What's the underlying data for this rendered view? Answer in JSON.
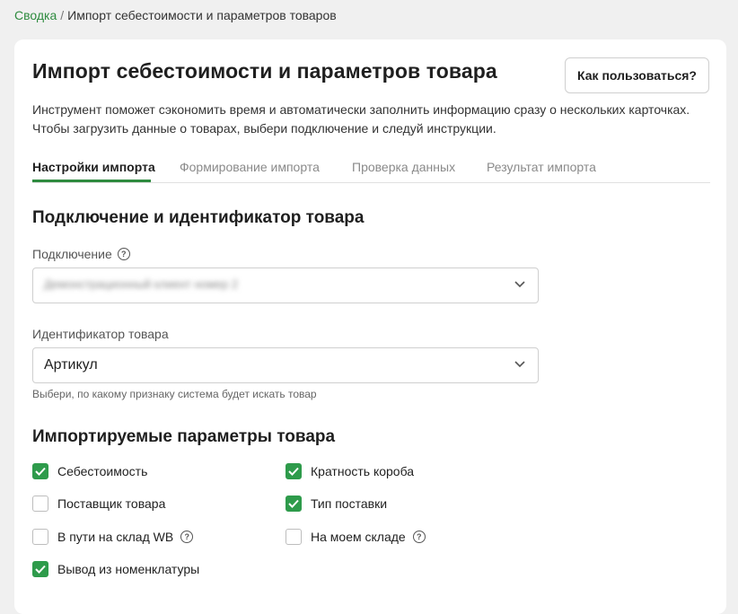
{
  "breadcrumb": {
    "root": "Сводка",
    "separator": "/",
    "current": "Импорт себестоимости и параметров товаров"
  },
  "header": {
    "title": "Импорт себестоимости и параметров товара",
    "help_button": "Как пользоваться?"
  },
  "description": {
    "line1": "Инструмент поможет сэкономить время и автоматически заполнить информацию сразу о нескольких карточках.",
    "line2": "Чтобы загрузить данные о товарах, выбери подключение и следуй инструкции."
  },
  "tabs": [
    {
      "label": "Настройки импорта",
      "active": true
    },
    {
      "label": "Формирование импорта",
      "active": false
    },
    {
      "label": "Проверка данных",
      "active": false
    },
    {
      "label": "Результат импорта",
      "active": false
    }
  ],
  "section1": {
    "title": "Подключение и идентификатор товара",
    "connection_label": "Подключение",
    "connection_value": "Демонстрационный клиент номер 2",
    "identifier_label": "Идентификатор товара",
    "identifier_value": "Артикул",
    "identifier_hint": "Выбери, по какому признаку система будет искать товар"
  },
  "section2": {
    "title": "Импортируемые параметры товара",
    "params": [
      {
        "label": "Себестоимость",
        "checked": true,
        "help": false
      },
      {
        "label": "Кратность короба",
        "checked": true,
        "help": false
      },
      {
        "label": "Поставщик товара",
        "checked": false,
        "help": false
      },
      {
        "label": "Тип поставки",
        "checked": true,
        "help": false
      },
      {
        "label": "В пути на склад WB",
        "checked": false,
        "help": true
      },
      {
        "label": "На моем складе",
        "checked": false,
        "help": true
      },
      {
        "label": "Вывод из номенклатуры",
        "checked": true,
        "help": false
      }
    ]
  },
  "colors": {
    "accent": "#2e9b4b",
    "link": "#2e8b3f"
  }
}
